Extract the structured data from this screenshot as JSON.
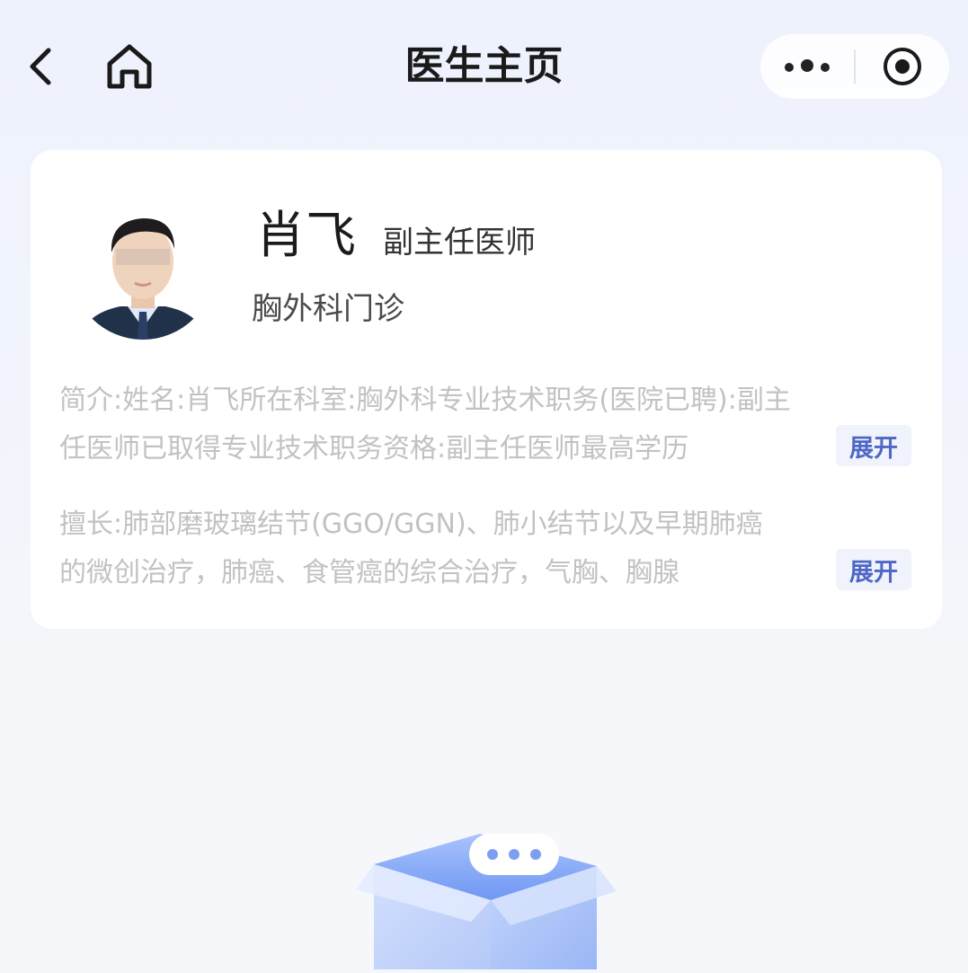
{
  "navbar": {
    "title": "医生主页",
    "back_icon": "chevron-left-icon",
    "home_icon": "home-icon",
    "more_icon": "more-dots-icon",
    "close_icon": "record-circle-icon"
  },
  "doctor": {
    "name": "肖飞",
    "title": "副主任医师",
    "department": "胸外科门诊",
    "intro_lines": [
      "简介:姓名:肖飞所在科室:胸外科专业技术职务(医院已聘):副主",
      "任医师已取得专业技术职务资格:副主任医师最高学历"
    ],
    "specialty_lines": [
      "擅长:肺部磨玻璃结节(GGO/GGN)、肺小结节以及早期肺癌",
      "的微创治疗，肺癌、食管癌的综合治疗，气胸、胸腺"
    ],
    "expand_label": "展开"
  },
  "colors": {
    "accent": "#4f67c5",
    "background": "#f6f7fb",
    "card": "#ffffff",
    "muted_text": "#c2c2c2"
  }
}
